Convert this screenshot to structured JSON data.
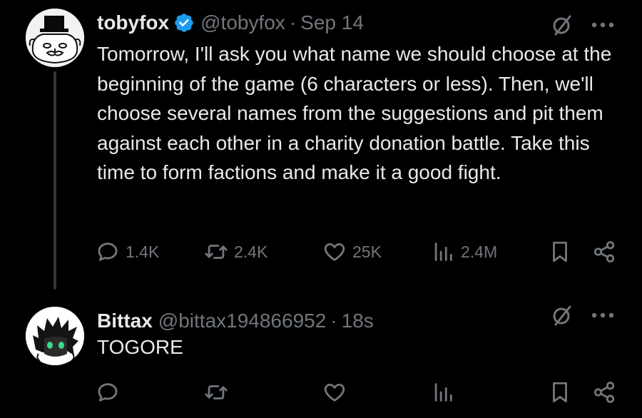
{
  "tweets": [
    {
      "display_name": "tobyfox",
      "handle": "@tobyfox",
      "separator": "·",
      "time": "Sep 14",
      "verified": true,
      "text": "Tomorrow, I'll ask you what name we should choose at the beginning of the game (6 characters or less). Then, we'll choose several names from the suggestions and pit them against each other in a charity donation battle. Take this time to form factions and make it a good fight.",
      "stats": {
        "replies": "1.4K",
        "reposts": "2.4K",
        "likes": "25K",
        "views": "2.4M"
      }
    },
    {
      "display_name": "Bittax",
      "handle": "@bittax194866952",
      "separator": "·",
      "time": "18s",
      "verified": false,
      "text": "TOGORE",
      "stats": {
        "replies": "",
        "reposts": "",
        "likes": "",
        "views": ""
      }
    }
  ],
  "icons": [
    "reply-icon",
    "repost-icon",
    "like-icon",
    "views-icon",
    "bookmark-icon",
    "share-icon",
    "grok-icon",
    "more-icon",
    "verified-badge-icon"
  ],
  "colors": {
    "background": "#000000",
    "text": "#e7e9ea",
    "muted": "#71767b",
    "verified": "#1d9bf0",
    "thread_line": "#333639"
  }
}
